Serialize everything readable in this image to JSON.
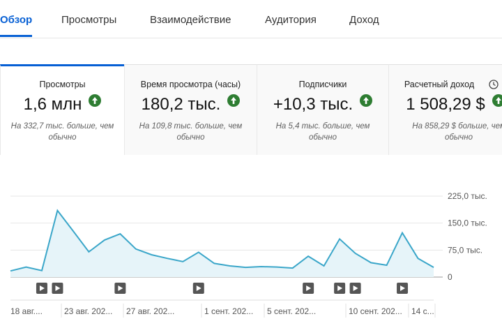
{
  "tabs": [
    {
      "label": "Обзор",
      "active": true
    },
    {
      "label": "Просмотры"
    },
    {
      "label": "Взаимодействие"
    },
    {
      "label": "Аудитория"
    },
    {
      "label": "Доход"
    }
  ],
  "cards": [
    {
      "title": "Просмотры",
      "value": "1,6 млн",
      "compare": "На 332,7 тыс. больше, чем обычно",
      "trend": "up-icon"
    },
    {
      "title": "Время просмотра (часы)",
      "value": "180,2 тыс.",
      "compare": "На 109,8 тыс. больше, чем обычно",
      "trend": "up-icon"
    },
    {
      "title": "Подписчики",
      "value": "+10,3 тыс.",
      "compare": "На 5,4 тыс. больше, чем обычно",
      "trend": "up-icon"
    },
    {
      "title": "Расчетный доход",
      "value": "1 508,29 $",
      "compare": "На 858,29 $ больше, чем обычно",
      "trend": "up-icon",
      "extra_icon": "clock-icon"
    }
  ],
  "colors": {
    "accent": "#065fd4",
    "line": "#3aa6c9",
    "area": "#e6f4f9",
    "up": "#2e7d32"
  },
  "chart_data": {
    "type": "area",
    "y_ticks": [
      "225,0 тыс.",
      "150,0 тыс.",
      "75,0 тыс.",
      "0"
    ],
    "ylim": [
      0,
      225000
    ],
    "x_tick_labels": [
      "18 авг....",
      "23 авг. 202...",
      "27 авг. 202...",
      "1 сент. 202...",
      "5 сент. 202...",
      "10 сент. 202...",
      "14 с..."
    ],
    "grid": true,
    "series": [
      {
        "values": [
          17000,
          28000,
          18000,
          185000,
          128000,
          70000,
          103000,
          120000,
          78000,
          62000,
          52000,
          43000,
          69000,
          38000,
          31000,
          27000,
          29000,
          28000,
          25000,
          58000,
          31000,
          106000,
          66000,
          40000,
          33000,
          123000,
          52000,
          27000
        ]
      }
    ],
    "video_markers": [
      2,
      3,
      7,
      12,
      19,
      21,
      22,
      25
    ]
  }
}
